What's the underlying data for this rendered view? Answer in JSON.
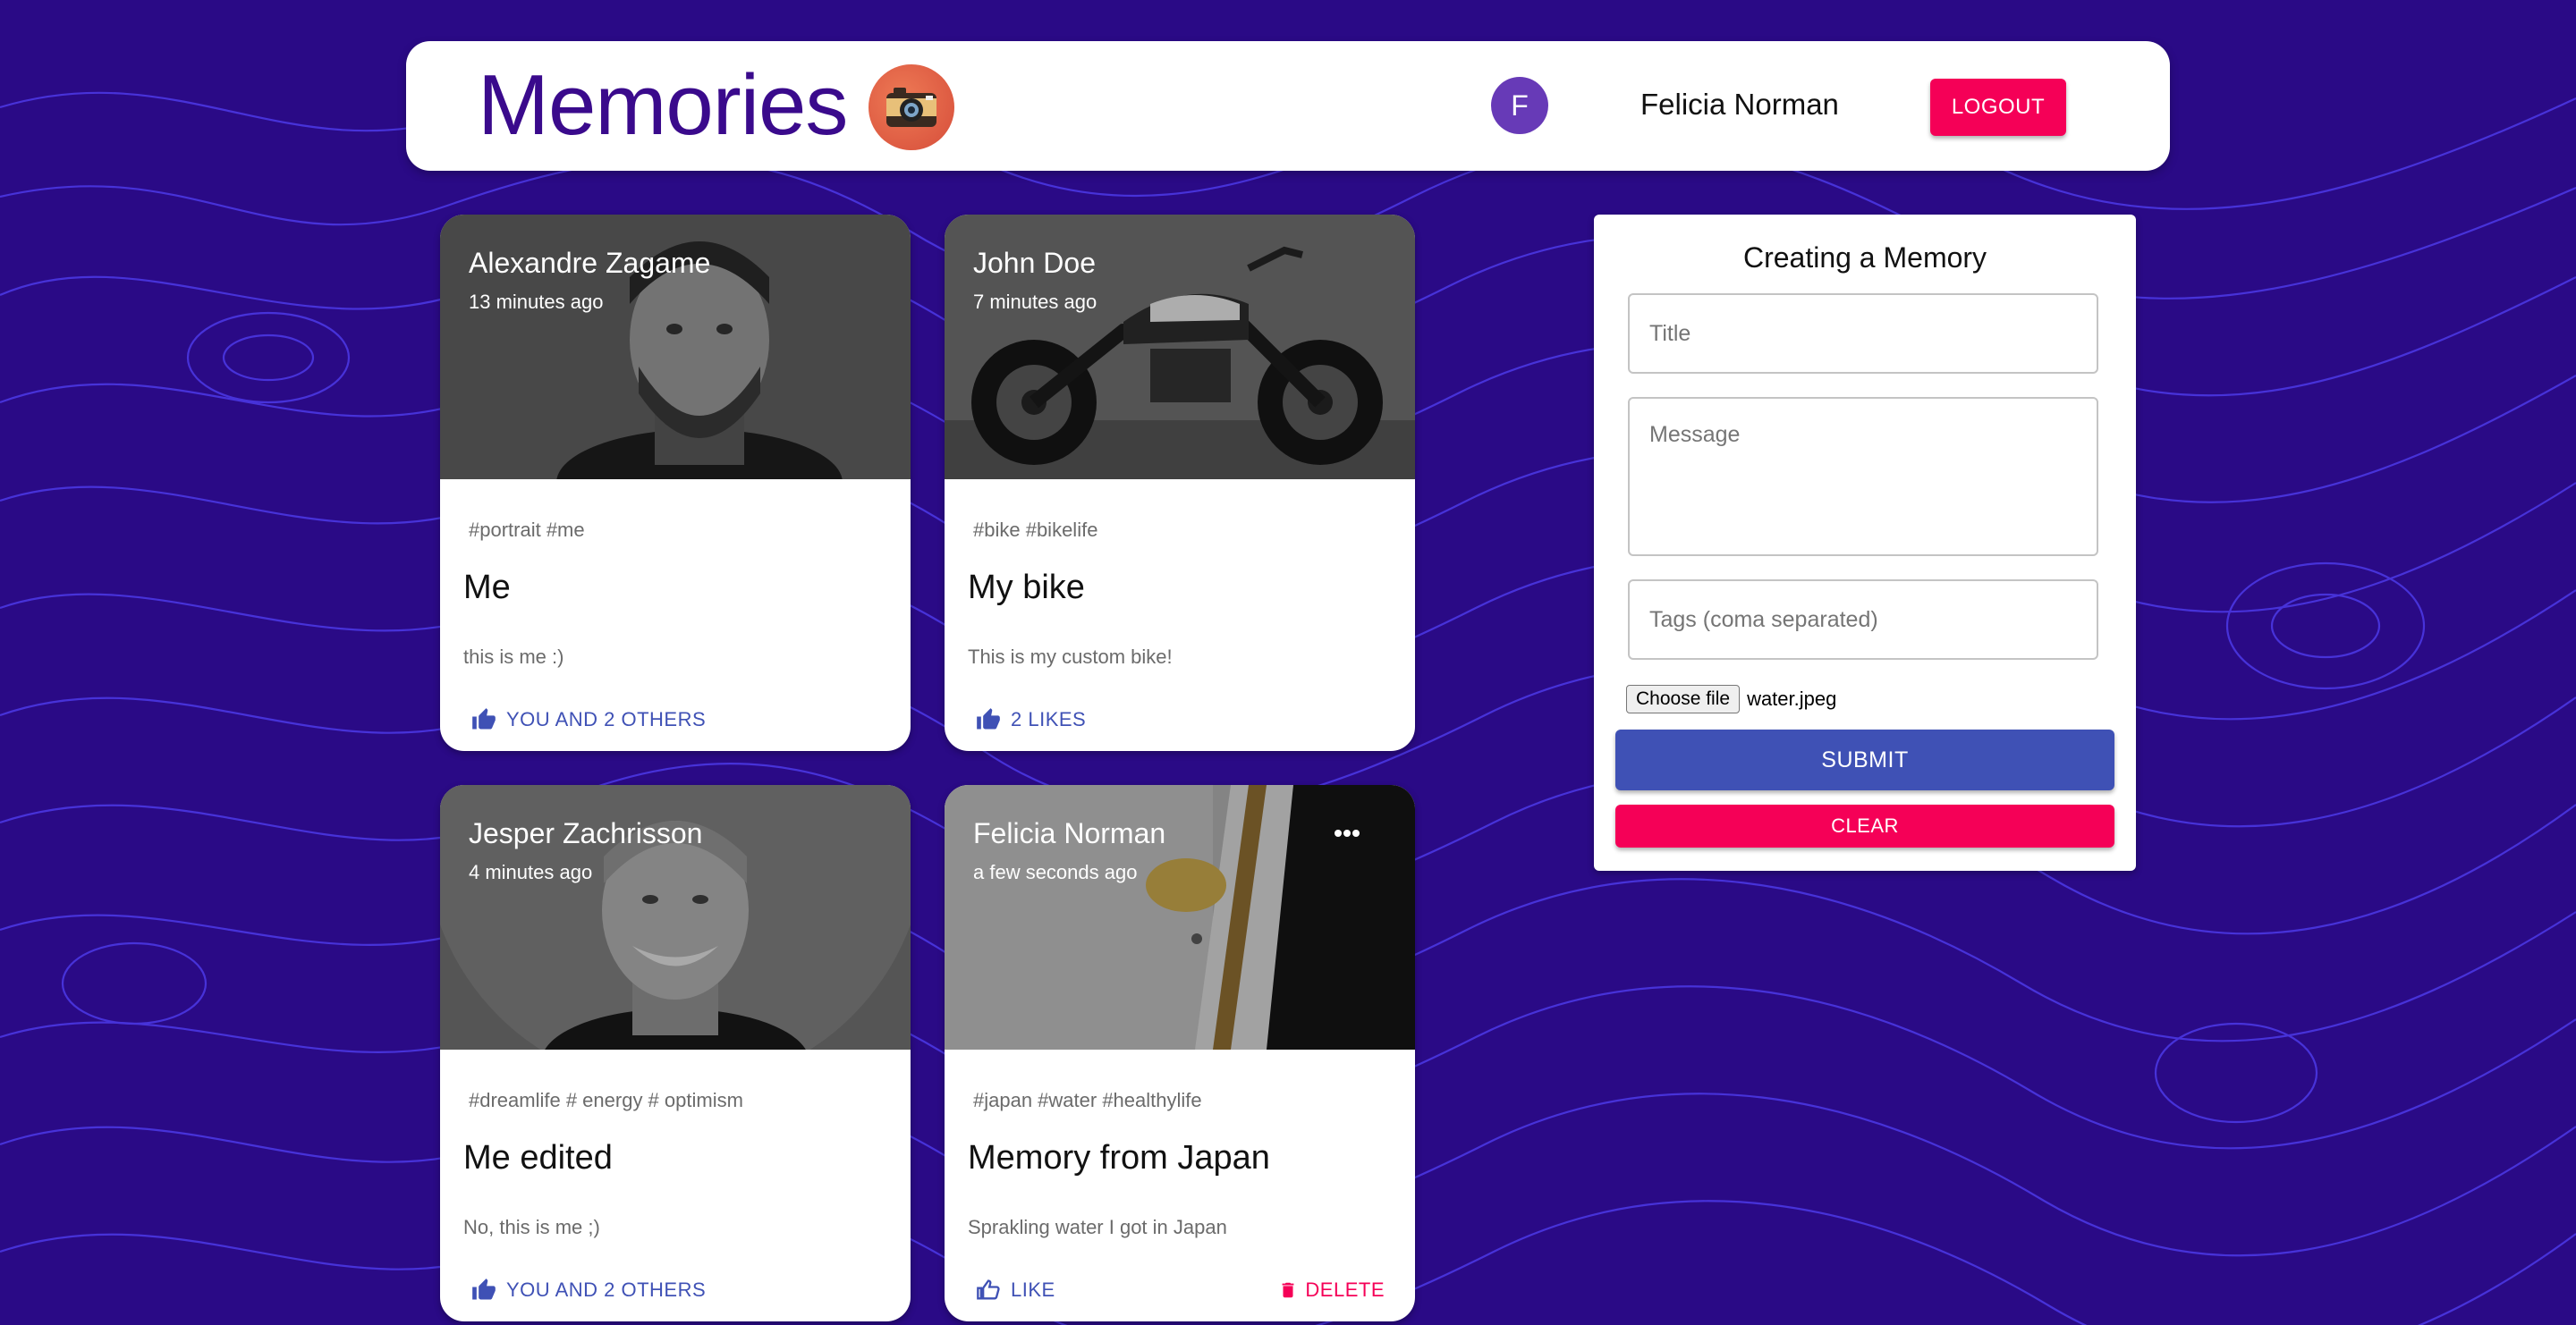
{
  "app": {
    "title": "Memories",
    "logo_icon": "camera-icon"
  },
  "user": {
    "initial": "F",
    "name": "Felicia Norman",
    "logout_label": "LOGOUT"
  },
  "colors": {
    "background": "#2a0a86",
    "primary": "#3f51b5",
    "secondary": "#f50057",
    "avatar": "#673ab7",
    "brand": "#3a0a8c"
  },
  "posts": [
    {
      "author": "Alexandre Zagame",
      "time": "13 minutes ago",
      "tags": "#portrait #me",
      "title": "Me",
      "message": "this is me :)",
      "likes": "YOU AND 2 OTHERS",
      "image": "portrait-photo"
    },
    {
      "author": "John Doe",
      "time": "7 minutes ago",
      "tags": "#bike #bikelife",
      "title": "My bike",
      "message": "This is my custom bike!",
      "likes": "2 LIKES",
      "image": "motorcycle-photo"
    },
    {
      "author": "Jesper Zachrisson",
      "time": "4 minutes ago",
      "tags": "#dreamlife # energy # optimism",
      "title": "Me edited",
      "message": "No, this is me ;)",
      "likes": "YOU AND 2 OTHERS",
      "image": "portrait-photo"
    },
    {
      "author": "Felicia Norman",
      "time": "a few seconds ago",
      "tags": "#japan #water #healthylife",
      "title": "Memory from Japan",
      "message": "Sprakling water I got in Japan",
      "likes": "LIKE",
      "delete_label": "DELETE",
      "image": "bottle-photo"
    }
  ],
  "form": {
    "heading": "Creating a Memory",
    "title_placeholder": "Title",
    "message_placeholder": "Message",
    "tags_placeholder": "Tags (coma separated)",
    "file_button": "Choose file",
    "file_name": "water.jpeg",
    "submit_label": "SUBMIT",
    "clear_label": "CLEAR"
  }
}
